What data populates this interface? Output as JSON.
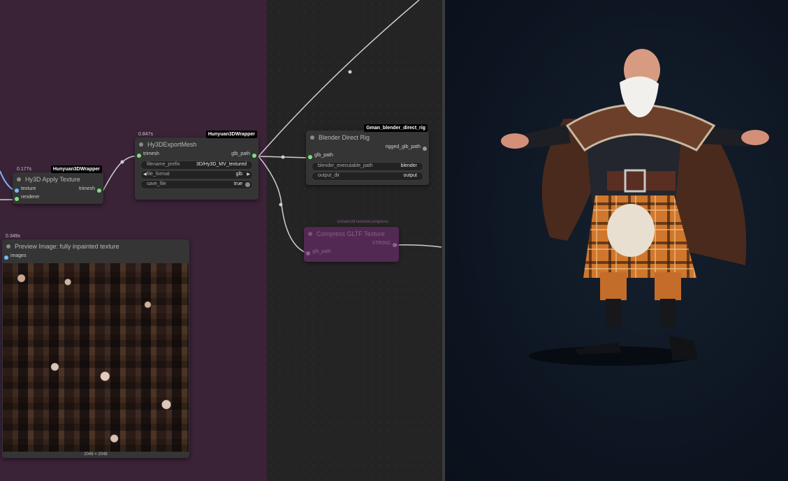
{
  "nodes": {
    "apply_texture": {
      "timing": "0.177s",
      "badge": "Hunyuan3DWrapper",
      "title": "Hy3D Apply Texture",
      "inputs": [
        "texture",
        "renderer"
      ],
      "output": "trimesh"
    },
    "export_mesh": {
      "timing": "0.847s",
      "badge": "Hunyuan3DWrapper",
      "title": "Hy3DExportMesh",
      "input": "trimesh",
      "output": "glb_path",
      "widgets": {
        "filename_prefix_label": "filename_prefix",
        "filename_prefix_value": "3D/Hy3D_MV_textured",
        "file_format_label": "file_format",
        "file_format_value": "glb",
        "save_file_label": "save_file",
        "save_file_value": "true"
      }
    },
    "blender_rig": {
      "badge": "Gman_blender_direct_rig",
      "title": "Blender Direct Rig",
      "output": "rigged_glb_path",
      "input": "glb_path",
      "widgets": {
        "exe_label": "blender_executable_path",
        "exe_value": "blender",
        "outdir_label": "output_dir",
        "outdir_value": "output"
      }
    },
    "compress": {
      "badge": "GmanGltfTextureCompress",
      "title": "Compress GLTF Texture",
      "input": "glb_path",
      "output": "STRING"
    },
    "preview": {
      "timing": "0.349s",
      "title": "Preview Image: fully inpainted texture",
      "input": "images",
      "caption": "2048 × 2048"
    }
  },
  "colors": {
    "group_bg": "#3a2237",
    "canvas_bg": "#242424",
    "node_bg": "#353535",
    "compress_bg": "#5b2a5c",
    "socket_green": "#7fe07f",
    "socket_blue": "#7ab8ff",
    "viewport_bg": "#0c1420"
  },
  "icons": [
    "node-status-dot",
    "arrow-left-icon",
    "arrow-right-icon",
    "toggle-icon"
  ]
}
